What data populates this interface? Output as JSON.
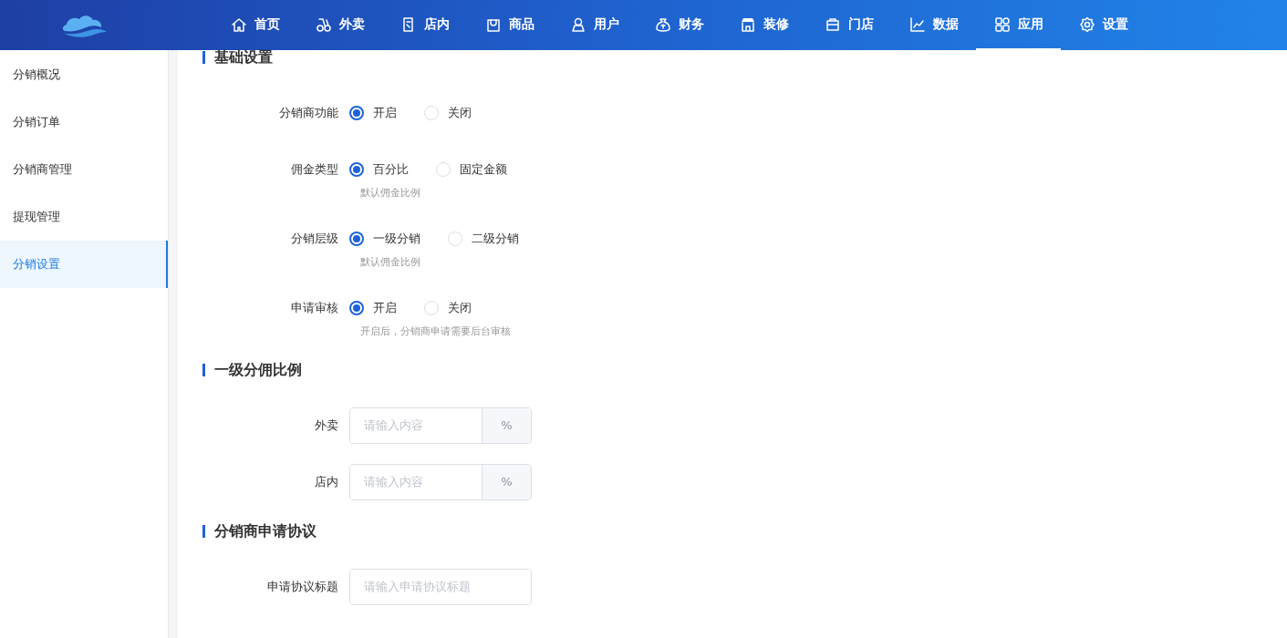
{
  "nav": [
    {
      "label": "首页",
      "selected": false
    },
    {
      "label": "外卖",
      "selected": false
    },
    {
      "label": "店内",
      "selected": false
    },
    {
      "label": "商品",
      "selected": false
    },
    {
      "label": "用户",
      "selected": false
    },
    {
      "label": "财务",
      "selected": false
    },
    {
      "label": "装修",
      "selected": false
    },
    {
      "label": "门店",
      "selected": false
    },
    {
      "label": "数据",
      "selected": false
    },
    {
      "label": "应用",
      "selected": true
    },
    {
      "label": "设置",
      "selected": false
    }
  ],
  "sidebar": {
    "items": [
      {
        "label": "分销概况",
        "selected": false
      },
      {
        "label": "分销订单",
        "selected": false
      },
      {
        "label": "分销商管理",
        "selected": false
      },
      {
        "label": "提现管理",
        "selected": false
      },
      {
        "label": "分销设置",
        "selected": true
      }
    ]
  },
  "sections": [
    {
      "title": "基础设置",
      "rows": [
        {
          "kind": "radio",
          "label": "分销商功能",
          "options": [
            {
              "label": "开启",
              "selected": true
            },
            {
              "label": "关闭",
              "selected": false
            }
          ]
        },
        {
          "kind": "radio",
          "label": "佣金类型",
          "options": [
            {
              "label": "百分比",
              "selected": true
            },
            {
              "label": "固定金额",
              "selected": false
            }
          ],
          "hint": "默认佣金比例"
        },
        {
          "kind": "radio",
          "label": "分销层级",
          "options": [
            {
              "label": "一级分销",
              "selected": true
            },
            {
              "label": "二级分销",
              "selected": false
            }
          ],
          "hint": "默认佣金比例"
        },
        {
          "kind": "radio",
          "label": "申请审核",
          "options": [
            {
              "label": "开启",
              "selected": true
            },
            {
              "label": "关闭",
              "selected": false
            }
          ],
          "hint": "开启后，分销商申请需要后台审核"
        }
      ]
    },
    {
      "title": "一级分佣比例",
      "rows": [
        {
          "kind": "addon",
          "label": "外卖",
          "placeholder": "请输入内容",
          "addon": "%"
        },
        {
          "kind": "addon",
          "label": "店内",
          "placeholder": "请输入内容",
          "addon": "%"
        }
      ]
    },
    {
      "title": "分销商申请协议",
      "rows": [
        {
          "kind": "input",
          "label": "申请协议标题",
          "placeholder": "请输入申请协议标题"
        }
      ]
    }
  ]
}
